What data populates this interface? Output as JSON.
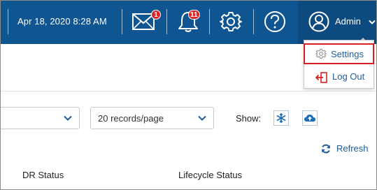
{
  "header": {
    "date_time": "Apr 18, 2020 8:28 AM",
    "messages_badge": "1",
    "notifications_badge": "11",
    "user_label": "Admin",
    "icons": [
      "mail-icon",
      "bell-icon",
      "gear-icon",
      "help-icon",
      "user-avatar-icon",
      "chevron-down-icon"
    ]
  },
  "user_menu": {
    "items": [
      {
        "label": "Settings",
        "icon": "gear-icon"
      },
      {
        "label": "Log Out",
        "icon": "logout-icon"
      }
    ]
  },
  "toolbar": {
    "first_select_value": "",
    "records_per_page": "20 records/page",
    "show_label": "Show:",
    "show_icons": [
      "snowflake-icon",
      "cloud-upload-icon"
    ],
    "refresh_label": "Refresh"
  },
  "table": {
    "columns": [
      "DR Status",
      "Lifecycle Status"
    ]
  },
  "colors": {
    "header_bg": "#0f5592",
    "admin_bg": "#0c4a80",
    "badge": "#d9262b",
    "link": "#1d5d9b",
    "highlight": "#d92020"
  }
}
